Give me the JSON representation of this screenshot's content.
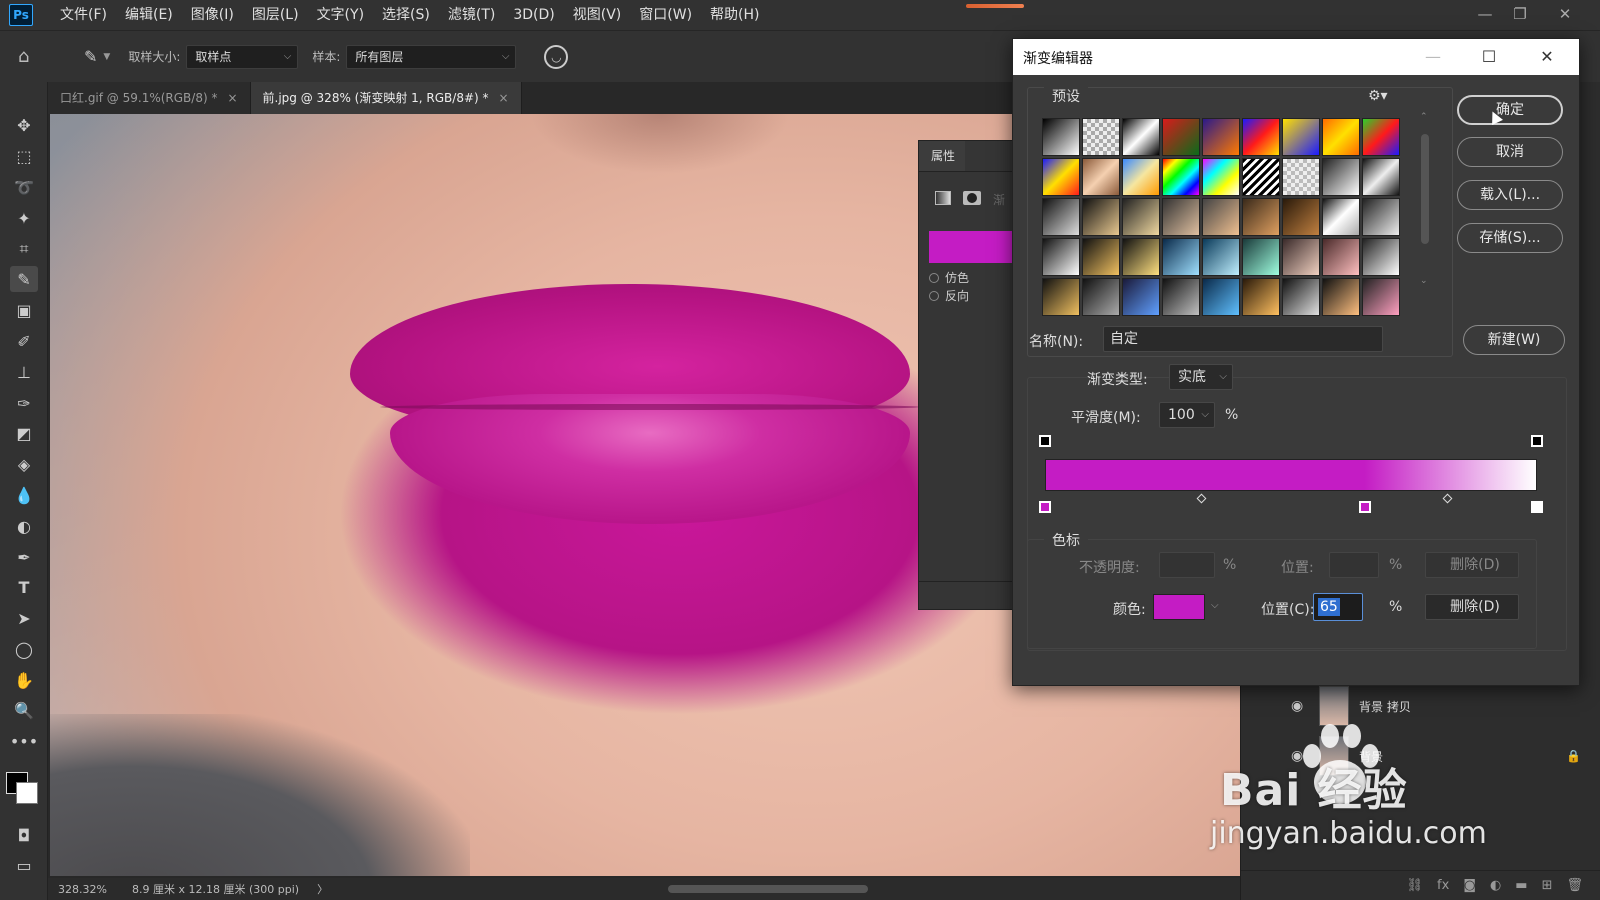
{
  "app": {
    "logo": "Ps",
    "menu": [
      "文件(F)",
      "编辑(E)",
      "图像(I)",
      "图层(L)",
      "文字(Y)",
      "选择(S)",
      "滤镜(T)",
      "3D(D)",
      "视图(V)",
      "窗口(W)",
      "帮助(H)"
    ]
  },
  "options": {
    "sample_size_label": "取样大小:",
    "sample_size_value": "取样点",
    "sample_label": "样本:",
    "sample_value": "所有图层"
  },
  "tabs": [
    {
      "label": "口红.gif @ 59.1%(RGB/8) *",
      "close": "×"
    },
    {
      "label": "前.jpg @ 328% (渐变映射 1, RGB/8#) *",
      "close": "×"
    }
  ],
  "status": {
    "zoom": "328.32%",
    "doc_size": "8.9 厘米 x 12.18 厘米 (300 ppi)",
    "arrow": "〉"
  },
  "properties": {
    "tab": "属性",
    "fake_label": "渐",
    "dither": "仿色",
    "reverse": "反向",
    "swatch_color": "#c41cc4"
  },
  "dialog": {
    "title": "渐变编辑器",
    "presets_label": "预设",
    "buttons": {
      "ok": "确定",
      "cancel": "取消",
      "load": "载入(L)...",
      "save": "存储(S)...",
      "new": "新建(W)"
    },
    "name_label": "名称(N):",
    "name_value": "自定",
    "type_label": "渐变类型:",
    "type_value": "实底",
    "smooth_label": "平滑度(M):",
    "smooth_value": "100",
    "percent": "%",
    "stops_label": "色标",
    "opacity_label": "不透明度:",
    "opacity_pos_label": "位置:",
    "delete_label": "删除(D)",
    "color_label": "颜色:",
    "color_pos_label": "位置(C):",
    "color_pos_value": "65",
    "gradient": {
      "color_stops": [
        {
          "position": 0,
          "color": "#c41cc4"
        },
        {
          "position": 65,
          "color": "#c41cc4"
        },
        {
          "position": 100,
          "color": "#ffffff"
        }
      ],
      "opacity_stops": [
        0,
        100
      ],
      "midpoints": [
        32,
        82
      ]
    },
    "selected_color": "#c41cc4"
  },
  "layers": [
    {
      "name": "背景 拷贝"
    },
    {
      "name": "背景"
    }
  ],
  "watermark": {
    "brand": "Bai 经验",
    "url": "jingyan.baidu.com"
  },
  "colors": {
    "accent": "#31a8ff",
    "lipstick": "#c41cc4"
  }
}
